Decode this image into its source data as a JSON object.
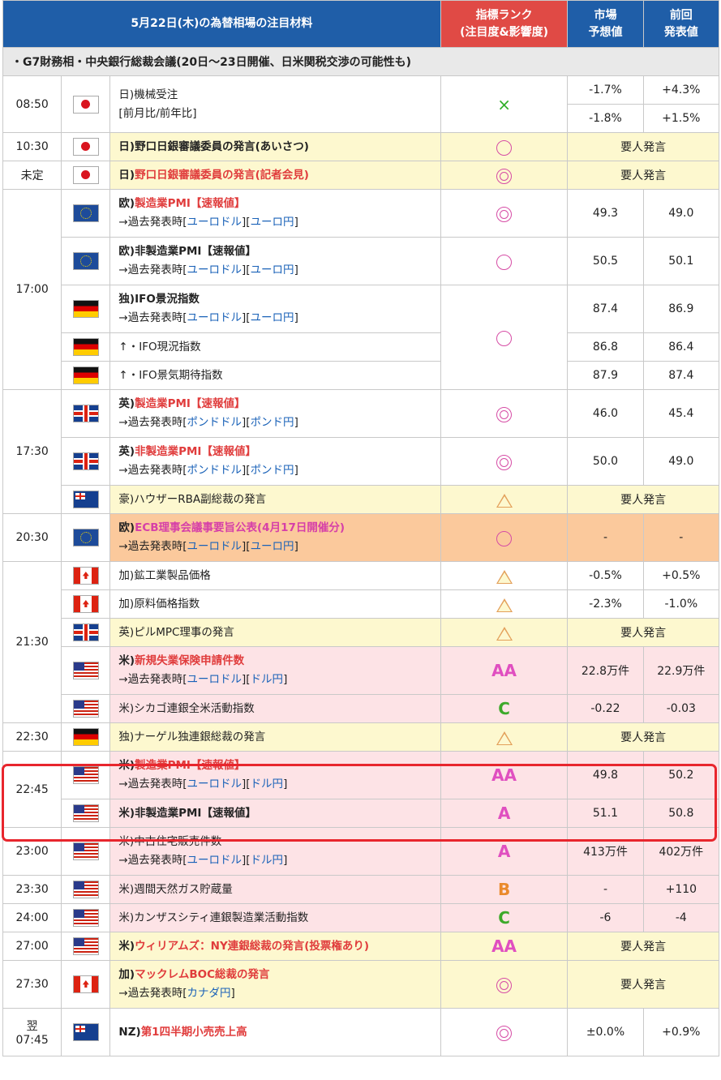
{
  "header": {
    "title": "5月22日(木)の為替相場の注目材料",
    "rank_line1": "指標ランク",
    "rank_line2": "(注目度&影響度)",
    "forecast_line1": "市場",
    "forecast_line2": "予想値",
    "previous_line1": "前回",
    "previous_line2": "発表値"
  },
  "note": "・G7財務相・中央銀行総裁会議(20日〜23日開催、日米関税交渉の可能性も)",
  "colors": {
    "header_bg": "#1f5ea8",
    "rank_header_bg": "#e04a45",
    "yellow_row": "#fdf8cf",
    "pink_row": "#fde3e6",
    "orange_row": "#fbc99c",
    "highlight_border": "#e8262d"
  },
  "speech": "要人発言",
  "link_prefix": "→過去発表時",
  "rows": [
    {
      "time": "08:50",
      "flag": "jp",
      "name": "日)機械受注",
      "sub": "[前月比/前年比]",
      "rank": "×",
      "f1": "-1.7%",
      "p1": "+4.3%",
      "f2": "-1.8%",
      "p2": "+1.5%"
    },
    {
      "time": "10:30",
      "flag": "jp",
      "name": "日)野口日銀審議委員の発言(あいさつ)",
      "rank": "○"
    },
    {
      "time": "未定",
      "flag": "jp",
      "prefix": "日)",
      "name": "野口日銀審議委員の発言(記者会見)",
      "rank": "◎"
    },
    {
      "time": "17:00",
      "flag": "eu",
      "prefix": "欧)",
      "name": "製造業PMI【速報値】",
      "links": [
        "ユーロドル",
        "ユーロ円"
      ],
      "rank": "◎",
      "forecast": "49.3",
      "previous": "49.0"
    },
    {
      "flag": "eu",
      "name": "欧)非製造業PMI【速報値】",
      "links": [
        "ユーロドル",
        "ユーロ円"
      ],
      "rank": "○",
      "forecast": "50.5",
      "previous": "50.1"
    },
    {
      "flag": "de",
      "name": "独)IFO景況指数",
      "links": [
        "ユーロドル",
        "ユーロ円"
      ],
      "rank": "○",
      "forecast": "87.4",
      "previous": "86.9"
    },
    {
      "flag": "de",
      "name": "↑・IFO現況指数",
      "forecast": "86.8",
      "previous": "86.4"
    },
    {
      "flag": "de",
      "name": "↑・IFO景気期待指数",
      "forecast": "87.9",
      "previous": "87.4"
    },
    {
      "time": "17:30",
      "flag": "uk",
      "prefix": "英)",
      "name": "製造業PMI【速報値】",
      "links": [
        "ポンドドル",
        "ポンド円"
      ],
      "rank": "◎",
      "forecast": "46.0",
      "previous": "45.4"
    },
    {
      "flag": "uk",
      "prefix": "英)",
      "name": "非製造業PMI【速報値】",
      "links": [
        "ポンドドル",
        "ポンド円"
      ],
      "rank": "◎",
      "forecast": "50.0",
      "previous": "49.0"
    },
    {
      "flag": "au",
      "name": "豪)ハウザーRBA副総裁の発言",
      "rank": "△"
    },
    {
      "time": "20:30",
      "flag": "eu",
      "prefix": "欧)",
      "name": "ECB理事会議事要旨公表(4月17日開催分)",
      "links": [
        "ユーロドル",
        "ユーロ円"
      ],
      "rank": "○",
      "forecast": "-",
      "previous": "-"
    },
    {
      "flag": "ca",
      "name": "加)鉱工業製品価格",
      "rank": "△",
      "forecast": "-0.5%",
      "previous": "+0.5%"
    },
    {
      "flag": "ca",
      "name": "加)原料価格指数",
      "rank": "△",
      "forecast": "-2.3%",
      "previous": "-1.0%"
    },
    {
      "time": "21:30",
      "flag": "uk",
      "name": "英)ピルMPC理事の発言",
      "rank": "△"
    },
    {
      "flag": "us",
      "prefix": "米)",
      "name": "新規失業保険申請件数",
      "links": [
        "ユーロドル",
        "ドル円"
      ],
      "rank": "AA",
      "forecast": "22.8万件",
      "previous": "22.9万件"
    },
    {
      "flag": "us",
      "name": "米)シカゴ連銀全米活動指数",
      "rank": "C",
      "forecast": "-0.22",
      "previous": "-0.03"
    },
    {
      "time": "22:30",
      "flag": "de",
      "name": "独)ナーゲル独連銀総裁の発言",
      "rank": "△"
    },
    {
      "time": "22:45",
      "flag": "us",
      "prefix": "米)",
      "name": "製造業PMI【速報値】",
      "links": [
        "ユーロドル",
        "ドル円"
      ],
      "rank": "AA",
      "forecast": "49.8",
      "previous": "50.2"
    },
    {
      "flag": "us",
      "name": "米)非製造業PMI【速報値】",
      "rank": "A",
      "forecast": "51.1",
      "previous": "50.8"
    },
    {
      "time": "23:00",
      "flag": "us",
      "name": "米)中古住宅販売件数",
      "links": [
        "ユーロドル",
        "ドル円"
      ],
      "rank": "A",
      "forecast": "413万件",
      "previous": "402万件"
    },
    {
      "time": "23:30",
      "flag": "us",
      "name": "米)週間天然ガス貯蔵量",
      "rank": "B",
      "forecast": "-",
      "previous": "+110"
    },
    {
      "time": "24:00",
      "flag": "us",
      "name": "米)カンザスシティ連銀製造業活動指数",
      "rank": "C",
      "forecast": "-6",
      "previous": "-4"
    },
    {
      "time": "27:00",
      "flag": "us",
      "prefix": "米)",
      "name": "ウィリアムズ：NY連銀総裁の発言(投票権あり)",
      "rank": "AA"
    },
    {
      "time": "27:30",
      "flag": "ca",
      "prefix": "加)",
      "name": "マックレムBOC総裁の発言",
      "links": [
        "カナダ円"
      ],
      "rank": "◎"
    },
    {
      "time_line1": "翌",
      "time_line2": "07:45",
      "flag": "nz",
      "prefix": "NZ)",
      "name": "第1四半期小売売上高",
      "rank": "◎",
      "forecast": "±0.0%",
      "previous": "+0.9%"
    }
  ]
}
